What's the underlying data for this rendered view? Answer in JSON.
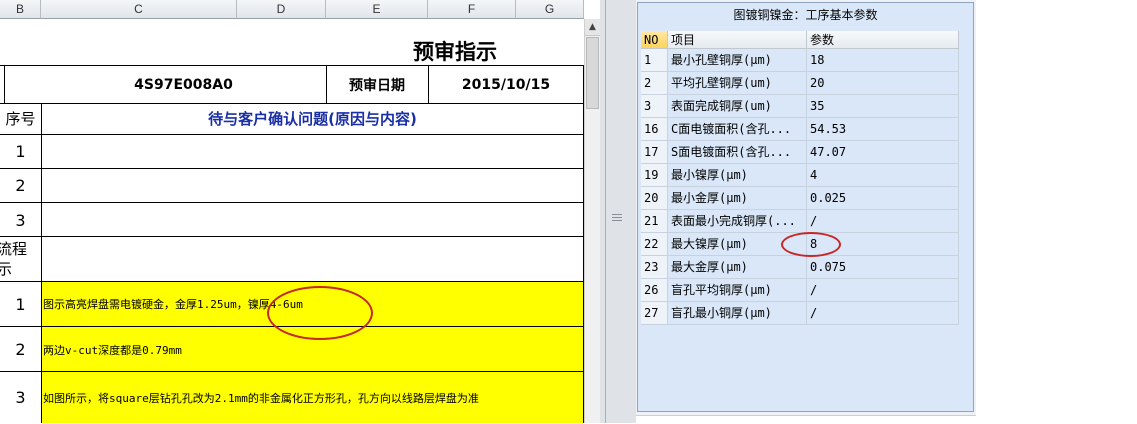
{
  "sheet": {
    "columns": [
      "B",
      "C",
      "D",
      "E",
      "F",
      "G"
    ],
    "title": "预审指示",
    "part_number": "4S97E008A0",
    "review_date_label": "预审日期",
    "review_date": "2015/10/15",
    "seq_header": "序号",
    "issues_header": "待与客户确认问题(原因与内容)",
    "issue_rows": [
      "1",
      "2",
      "3"
    ],
    "flow_label": "流程\n示",
    "instructions": [
      {
        "no": "1",
        "text": "图示高亮焊盘需电镀硬金，金厚1.25um，镍厚4-6um"
      },
      {
        "no": "2",
        "text": "两边v-cut深度都是0.79mm"
      },
      {
        "no": "3",
        "text": "如图所示，将square层钻孔孔改为2.1mm的非金属化正方形孔，孔方向以线路层焊盘为准"
      }
    ],
    "highlight_color": "#ffff00",
    "title_color": "#000000",
    "issues_header_color": "#1a2fa6"
  },
  "panel": {
    "title": "图镀铜镍金：工序基本参数",
    "headers": {
      "no": "NO",
      "item": "项目",
      "param": "参数"
    },
    "rows": [
      {
        "no": "1",
        "item": "最小孔壁铜厚(μm)",
        "value": "18"
      },
      {
        "no": "2",
        "item": "平均孔壁铜厚(um)",
        "value": "20"
      },
      {
        "no": "3",
        "item": "表面完成铜厚(um)",
        "value": "35"
      },
      {
        "no": "16",
        "item": "C面电镀面积(含孔...",
        "value": "54.53"
      },
      {
        "no": "17",
        "item": "S面电镀面积(含孔...",
        "value": "47.07"
      },
      {
        "no": "19",
        "item": "最小镍厚(μm)",
        "value": "4"
      },
      {
        "no": "20",
        "item": "最小金厚(μm)",
        "value": "0.025"
      },
      {
        "no": "21",
        "item": "表面最小完成铜厚(...",
        "value": "/"
      },
      {
        "no": "22",
        "item": "最大镍厚(μm)",
        "value": "8"
      },
      {
        "no": "23",
        "item": "最大金厚(μm)",
        "value": "0.075"
      },
      {
        "no": "26",
        "item": "盲孔平均铜厚(μm)",
        "value": "/"
      },
      {
        "no": "27",
        "item": "盲孔最小铜厚(μm)",
        "value": "/"
      }
    ],
    "annotation_color": "#c62828"
  }
}
